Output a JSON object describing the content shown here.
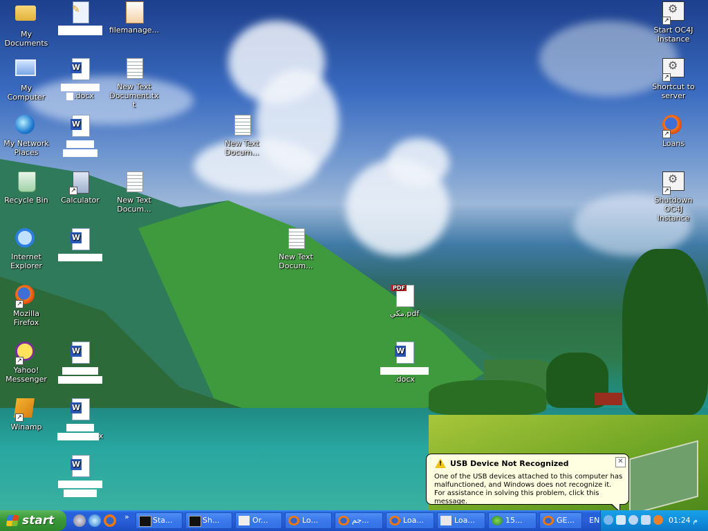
{
  "desktop_icons": {
    "my_documents": "My Documents",
    "my_computer": "My Computer",
    "my_network_places": "My Network Places",
    "recycle_bin": "Recycle Bin",
    "internet_explorer": "Internet Explorer",
    "mozilla_firefox": "Mozilla Firefox",
    "yahoo_messenger": "Yahoo! Messenger",
    "winamp": "Winamp",
    "filemanager": "filemanage...",
    "doc_docx": ".docx",
    "new_text_document_txt": "New Text Document.txt",
    "calculator": "Calculator",
    "new_text_docum_1": "New Text Docum...",
    "new_text_docum_2": "New Text Docum...",
    "new_text_docum_3": "New Text Docum...",
    "pdf_file": "مكي.pdf",
    "docx_file": ".docx",
    "x_suffix": "x",
    "start_oc4j": "Start OC4J Instance",
    "shortcut_to_server": "Shortcut to server",
    "loans": "Loans",
    "shutdown_oc4j": "Shutdown OC4J Instance"
  },
  "balloon": {
    "title": "USB Device Not Recognized",
    "line1": "One of the USB devices attached to this computer has",
    "line2": "malfunctioned, and Windows does not recognize it.",
    "line3": "For assistance in solving this problem, click this message.",
    "close": "✕"
  },
  "taskbar": {
    "start_label": "start",
    "chevron": "»",
    "buttons": [
      "Sta...",
      "Sh...",
      "Or...",
      "Lo...",
      "جم...",
      "Loa...",
      "Loa...",
      "15...",
      "GE..."
    ],
    "lang": "EN",
    "clock": "01:24 م"
  }
}
